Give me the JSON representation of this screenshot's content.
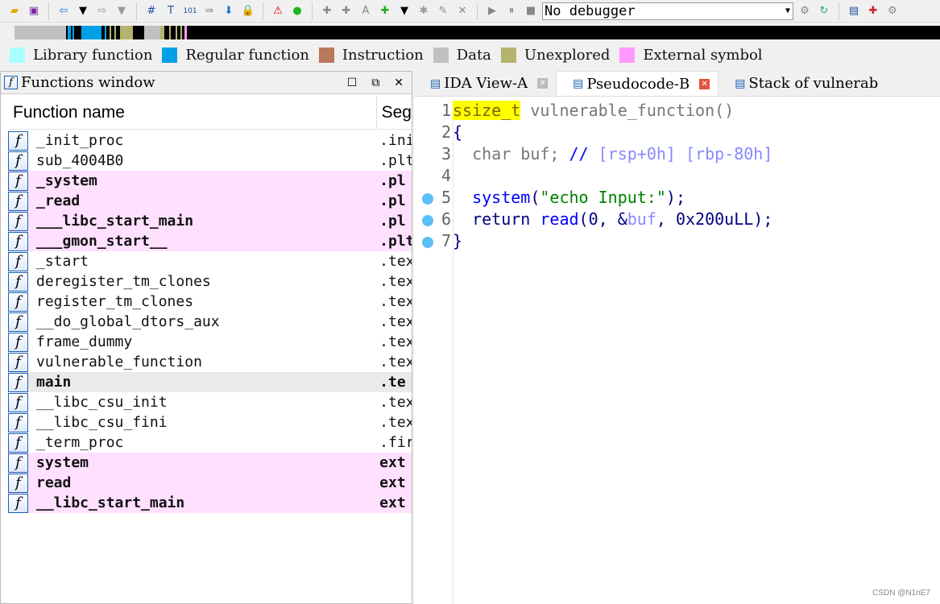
{
  "toolbar": {
    "debugger_select": "No debugger",
    "icons": [
      "open-icon",
      "save-icon",
      "back-icon",
      "dropdown-icon",
      "forward-icon",
      "dropdown-icon",
      "search-hex-icon",
      "search-text-icon",
      "search-binary-icon",
      "jump-icon",
      "down-arrow-icon",
      "lock-icon",
      "warning-icon",
      "green-circle-icon",
      "code-icon",
      "data-icon",
      "string-icon",
      "struct-icon",
      "dropdown-icon",
      "star-icon",
      "edit-icon",
      "close-icon",
      "play-icon",
      "pause-icon",
      "stop-icon"
    ]
  },
  "legend": [
    {
      "label": "Library function",
      "color": "#aaffff"
    },
    {
      "label": "Regular function",
      "color": "#00a0e6"
    },
    {
      "label": "Instruction",
      "color": "#b8785a"
    },
    {
      "label": "Data",
      "color": "#c0c0c0"
    },
    {
      "label": "Unexplored",
      "color": "#b4b46e"
    },
    {
      "label": "External symbol",
      "color": "#ff99ff"
    }
  ],
  "functions_window": {
    "title": "Functions window",
    "columns": [
      "Function name",
      "Seg"
    ],
    "rows": [
      {
        "name": "_init_proc",
        "seg": ".ini",
        "type": "normal"
      },
      {
        "name": "sub_4004B0",
        "seg": ".plt",
        "type": "normal"
      },
      {
        "name": "_system",
        "seg": ".pl",
        "type": "ext"
      },
      {
        "name": "_read",
        "seg": ".pl",
        "type": "ext"
      },
      {
        "name": "___libc_start_main",
        "seg": ".pl",
        "type": "ext"
      },
      {
        "name": "___gmon_start__",
        "seg": ".plt",
        "type": "ext"
      },
      {
        "name": "_start",
        "seg": ".tex",
        "type": "normal"
      },
      {
        "name": "deregister_tm_clones",
        "seg": ".tex",
        "type": "normal"
      },
      {
        "name": "register_tm_clones",
        "seg": ".tex",
        "type": "normal"
      },
      {
        "name": "__do_global_dtors_aux",
        "seg": ".tex",
        "type": "normal"
      },
      {
        "name": "frame_dummy",
        "seg": ".tex",
        "type": "normal"
      },
      {
        "name": "vulnerable_function",
        "seg": ".tex",
        "type": "normal"
      },
      {
        "name": "main",
        "seg": ".te",
        "type": "sel"
      },
      {
        "name": "__libc_csu_init",
        "seg": ".tex",
        "type": "normal"
      },
      {
        "name": "__libc_csu_fini",
        "seg": ".tex",
        "type": "normal"
      },
      {
        "name": "_term_proc",
        "seg": ".fir",
        "type": "normal"
      },
      {
        "name": "system",
        "seg": "ext",
        "type": "ext"
      },
      {
        "name": "read",
        "seg": "ext",
        "type": "ext"
      },
      {
        "name": "__libc_start_main",
        "seg": "ext",
        "type": "ext"
      }
    ]
  },
  "tabs": [
    {
      "label": "IDA View-A"
    },
    {
      "label": "Pseudocode-B",
      "active": true
    },
    {
      "label": "Stack of vulnerab"
    }
  ],
  "code": {
    "l1a": "ssize_t",
    "l1b": " vulnerable_function()",
    "l2": "{",
    "l3a": "  char buf; ",
    "l3b": "// ",
    "l3c": "[rsp+0h] [rbp-80h]",
    "l5a": "  system",
    "l5b": "(",
    "l5c": "\"echo Input:\"",
    "l5d": ");",
    "l6a": "  return ",
    "l6b": "read",
    "l6c": "(0, &",
    "l6d": "buf",
    "l6e": ", 0x200uLL);",
    "l7": "}",
    "line_numbers": [
      "1",
      "2",
      "3",
      "4",
      "5",
      "6",
      "7"
    ]
  },
  "watermark": "CSDN @N1nE7"
}
